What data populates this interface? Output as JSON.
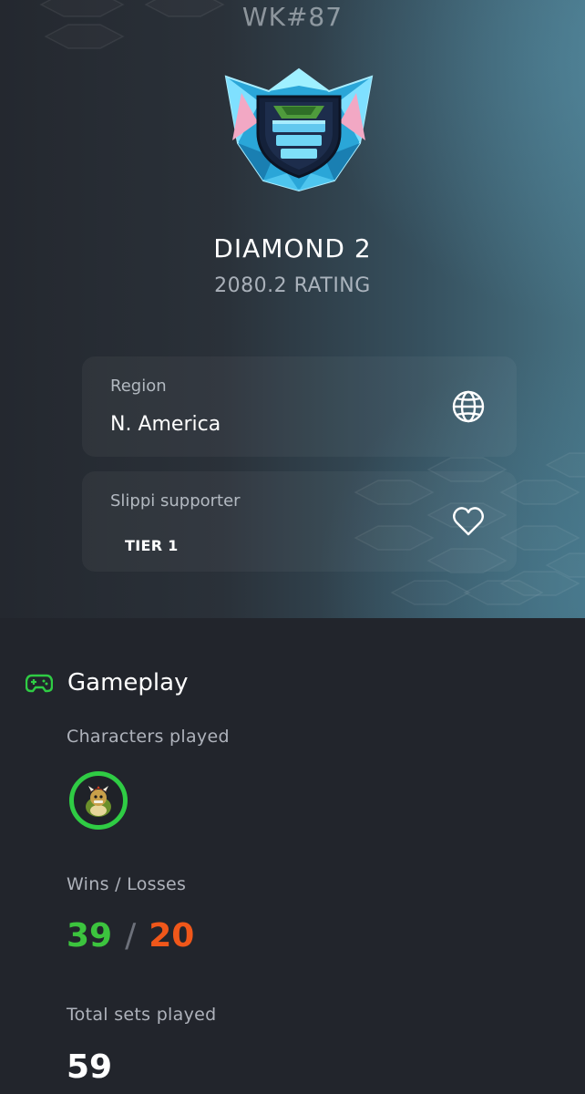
{
  "player": {
    "connect_code": "WK#87",
    "rank": "DIAMOND 2",
    "rating": "2080.2 RATING",
    "rank_icon": "diamond-rank-icon"
  },
  "cards": {
    "region": {
      "label": "Region",
      "value": "N. America",
      "icon": "globe-icon"
    },
    "supporter": {
      "label": "Slippi supporter",
      "value": "TIER 1",
      "icon": "heart-icon"
    }
  },
  "gameplay": {
    "title": "Gameplay",
    "icon": "gamepad-icon",
    "characters_label": "Characters played",
    "characters": [
      {
        "icon": "bowser-icon"
      }
    ],
    "wl_label": "Wins / Losses",
    "wins": "39",
    "separator": "/",
    "losses": "20",
    "sets_label": "Total sets played",
    "sets_value": "59"
  },
  "colors": {
    "accent_green": "#2fcc44",
    "wins": "#3cc43e",
    "losses": "#f0571a",
    "background": "#22252c",
    "rank_blue": "#5fd0f2"
  }
}
